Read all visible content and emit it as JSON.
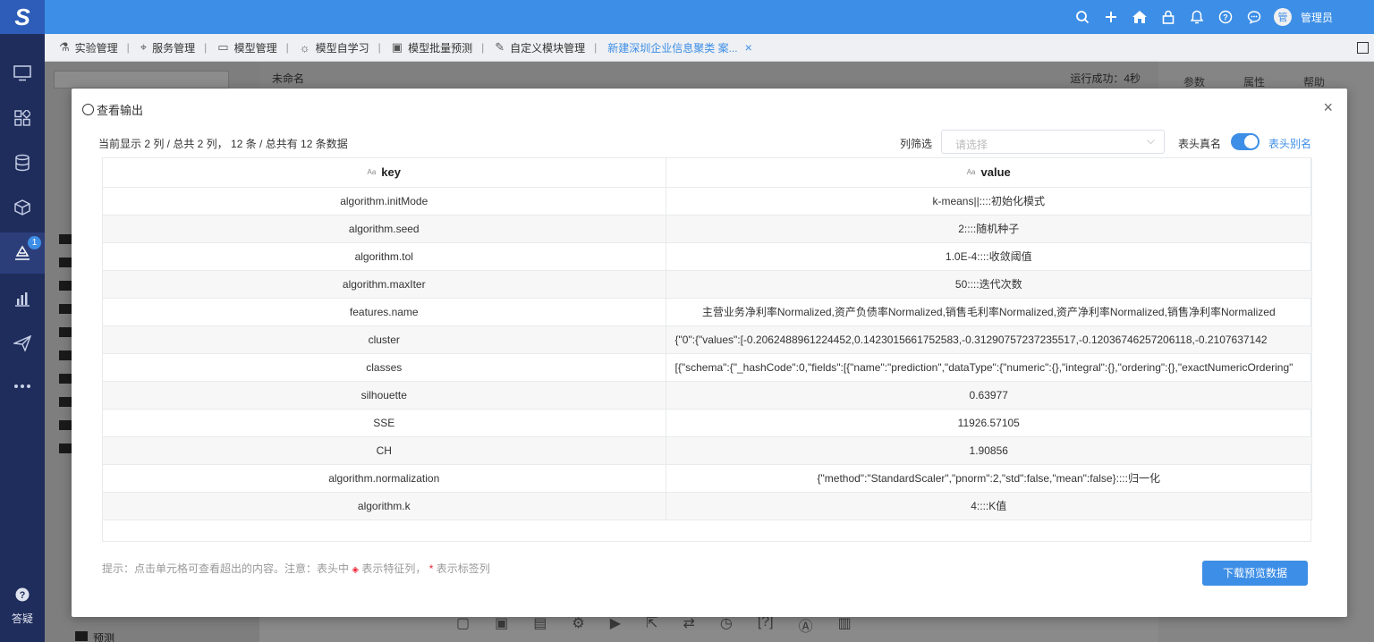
{
  "top_bar": {
    "logo_text": "S",
    "icons": [
      "search-icon",
      "plus-icon",
      "home-icon",
      "lock-icon",
      "bell-icon",
      "help-icon",
      "chat-icon"
    ],
    "avatar_text": "管",
    "user_name": "管理员"
  },
  "sidebar": {
    "items": [
      "monitor-icon",
      "apps-icon",
      "database-icon",
      "cube-icon",
      "modeling-icon",
      "chart-icon",
      "send-icon",
      "more-icon"
    ],
    "badge": "1",
    "help_label": "答疑"
  },
  "tabs": [
    {
      "label": "实验管理"
    },
    {
      "label": "服务管理"
    },
    {
      "label": "模型管理"
    },
    {
      "label": "模型自学习"
    },
    {
      "label": "模型批量预测"
    },
    {
      "label": "自定义模块管理"
    },
    {
      "label": "新建深圳企业信息聚类 案..."
    }
  ],
  "workspace": {
    "experiment_name": "未命名",
    "run_status": "运行成功：4秒",
    "right_tabs": [
      "参数",
      "属性",
      "帮助"
    ],
    "folder_label": "预测"
  },
  "modal": {
    "title": "查看输出",
    "info": "当前显示 2 列 / 总共 2 列， 12 条 / 总共有 12 条数据",
    "filter_label": "列筛选",
    "filter_placeholder": "请选择",
    "header_real_name": "表头真名",
    "header_alias": "表头别名",
    "columns": [
      "key",
      "value"
    ],
    "tip": "提示：点击单元格可查看超出的内容。注意：表头中",
    "tip_feature": "表示特征列，",
    "tip_label": "表示标签列",
    "download_label": "下载预览数据"
  },
  "table_rows": [
    {
      "key": "algorithm.initMode",
      "value": "k-means||::::初始化模式"
    },
    {
      "key": "algorithm.seed",
      "value": "2::::随机种子"
    },
    {
      "key": "algorithm.tol",
      "value": "1.0E-4::::收敛阈值"
    },
    {
      "key": "algorithm.maxIter",
      "value": "50::::迭代次数"
    },
    {
      "key": "features.name",
      "value": "主营业务净利率Normalized,资产负债率Normalized,销售毛利率Normalized,资产净利率Normalized,销售净利率Normalized"
    },
    {
      "key": "cluster",
      "value": "{\"0\":{\"values\":[-0.2062488961224452,0.1423015661752583,-0.31290757237235517,-0.12036746257206118,-0.2107637142"
    },
    {
      "key": "classes",
      "value": "[{\"schema\":{\"_hashCode\":0,\"fields\":[{\"name\":\"prediction\",\"dataType\":{\"numeric\":{},\"integral\":{},\"ordering\":{},\"exactNumericOrdering\""
    },
    {
      "key": "silhouette",
      "value": "0.63977"
    },
    {
      "key": "SSE",
      "value": "11926.57105"
    },
    {
      "key": "CH",
      "value": "1.90856"
    },
    {
      "key": "algorithm.normalization",
      "value": "{\"method\":\"StandardScaler\",\"pnorm\":2,\"std\":false,\"mean\":false}::::归一化"
    },
    {
      "key": "algorithm.k",
      "value": "4::::K值"
    }
  ]
}
